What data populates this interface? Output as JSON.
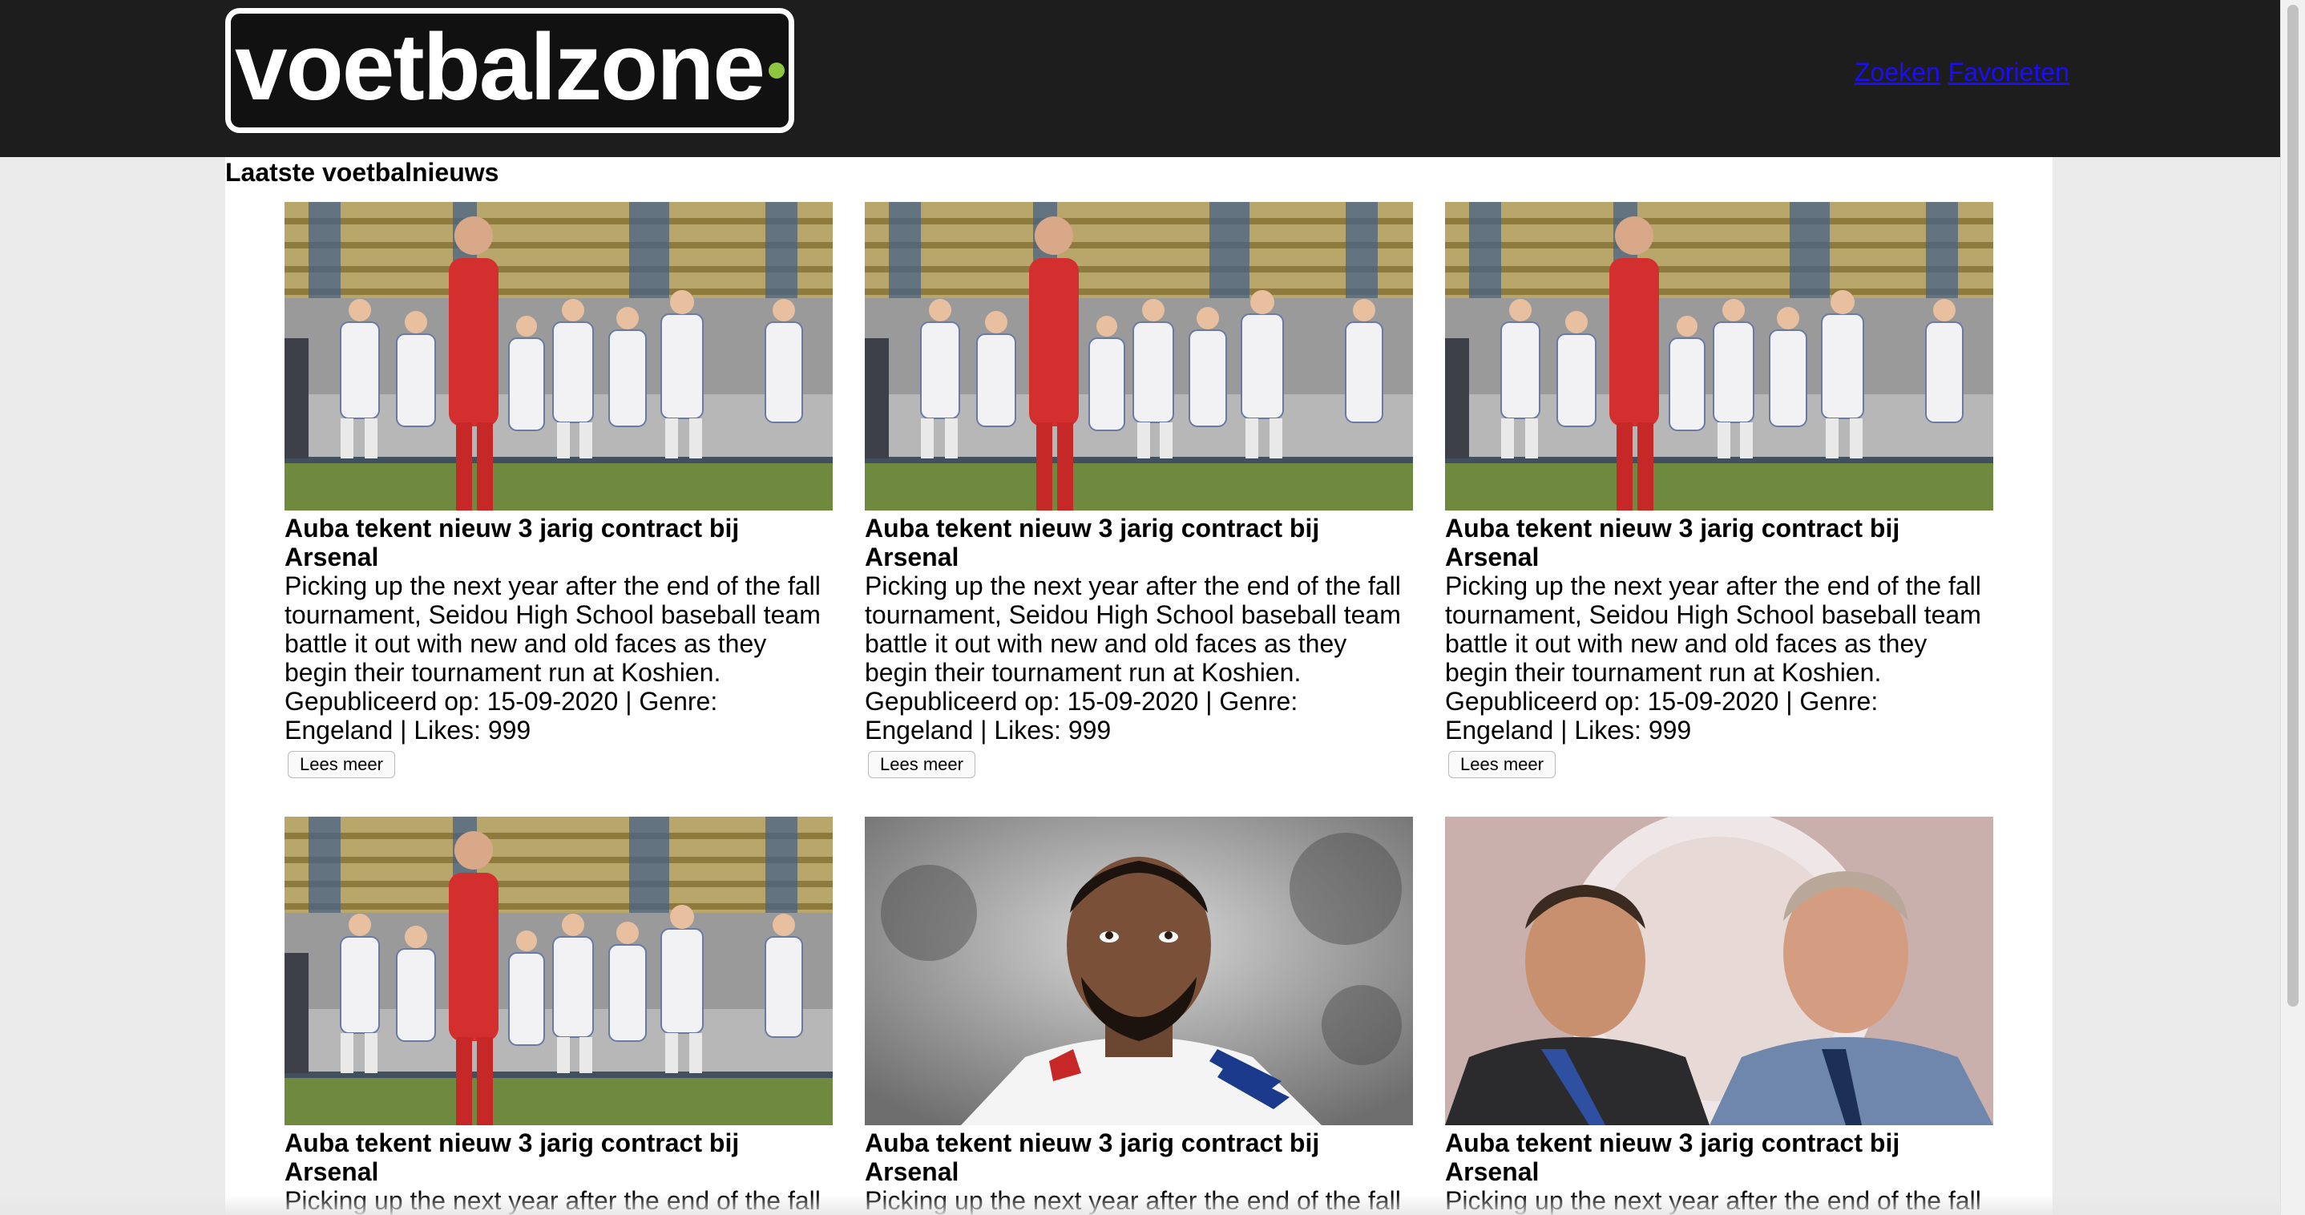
{
  "header": {
    "logo_text": "voetbalzone",
    "nav": [
      "Zoeken",
      "Favorieten"
    ]
  },
  "section_title": "Laatste voetbalnieuws",
  "articles": [
    {
      "image": "team-celebration",
      "title": "Auba tekent nieuw 3 jarig contract bij Arsenal",
      "description": "Picking up the next year after the end of the fall tournament, Seidou High School baseball team battle it out with new and old faces as they begin their tournament run at Koshien.",
      "meta": "Gepubliceerd op: 15-09-2020 | Genre: Engeland | Likes: 999",
      "button": "Lees meer"
    },
    {
      "image": "team-celebration",
      "title": "Auba tekent nieuw 3 jarig contract bij Arsenal",
      "description": "Picking up the next year after the end of the fall tournament, Seidou High School baseball team battle it out with new and old faces as they begin their tournament run at Koshien.",
      "meta": "Gepubliceerd op: 15-09-2020 | Genre: Engeland | Likes: 999",
      "button": "Lees meer"
    },
    {
      "image": "team-celebration",
      "title": "Auba tekent nieuw 3 jarig contract bij Arsenal",
      "description": "Picking up the next year after the end of the fall tournament, Seidou High School baseball team battle it out with new and old faces as they begin their tournament run at Koshien.",
      "meta": "Gepubliceerd op: 15-09-2020 | Genre: Engeland | Likes: 999",
      "button": "Lees meer"
    },
    {
      "image": "team-celebration",
      "title": "Auba tekent nieuw 3 jarig contract bij Arsenal",
      "description": "Picking up the next year after the end of the fall",
      "meta": "",
      "button": ""
    },
    {
      "image": "player-portrait",
      "title": "Auba tekent nieuw 3 jarig contract bij Arsenal",
      "description": "Picking up the next year after the end of the fall",
      "meta": "",
      "button": ""
    },
    {
      "image": "two-men-portrait",
      "title": "Auba tekent nieuw 3 jarig contract bij Arsenal",
      "description": "Picking up the next year after the end of the fall",
      "meta": "",
      "button": ""
    }
  ],
  "colors": {
    "header_bg": "#1d1d1d",
    "link": "#1a0dff",
    "logo_dot": "#8dc63f",
    "page_bg": "#ebebeb"
  }
}
